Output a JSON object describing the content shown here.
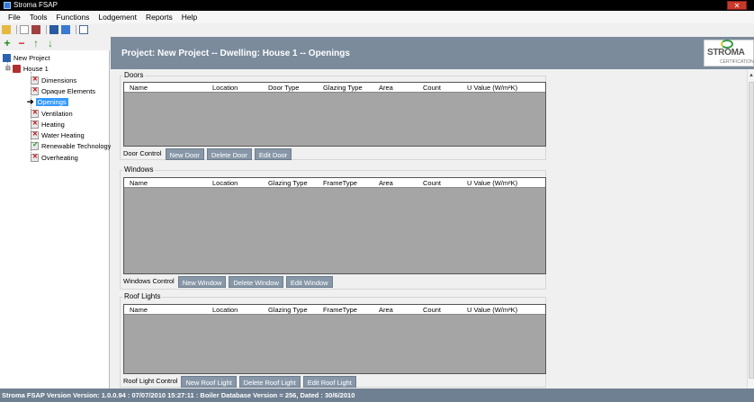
{
  "window": {
    "title": "Stroma FSAP",
    "close_label": "✕"
  },
  "menu": [
    "File",
    "Tools",
    "Functions",
    "Lodgement",
    "Reports",
    "Help"
  ],
  "toolbar2": {
    "add": "+",
    "remove": "−",
    "up": "↑",
    "down": "↓"
  },
  "tree": {
    "project": "New Project",
    "house": "House 1",
    "items": [
      {
        "label": "Dimensions",
        "status": "x"
      },
      {
        "label": "Opaque Elements",
        "status": "x"
      },
      {
        "label": "Openings",
        "status": "arrow"
      },
      {
        "label": "Ventilation",
        "status": "x"
      },
      {
        "label": "Heating",
        "status": "x"
      },
      {
        "label": "Water Heating",
        "status": "x"
      },
      {
        "label": "Renewable Technology",
        "status": "check"
      },
      {
        "label": "Overheating",
        "status": "x"
      }
    ]
  },
  "header": {
    "title": "Project: New Project -- Dwelling: House 1 -- Openings"
  },
  "logo": {
    "text": "STROMA",
    "subtitle": "CERTIFICATION"
  },
  "doors": {
    "label": "Doors",
    "columns": [
      "Name",
      "Location",
      "Door Type",
      "Glazing Type",
      "Area",
      "Count",
      "U Value (W/m²K)"
    ],
    "control_label": "Door Control",
    "buttons": [
      "New Door",
      "Delete Door",
      "Edit Door"
    ]
  },
  "windows": {
    "label": "Windows",
    "columns": [
      "Name",
      "Location",
      "Glazing Type",
      "FrameType",
      "Area",
      "Count",
      "U Value (W/m²K)"
    ],
    "control_label": "Windows Control",
    "buttons": [
      "New Window",
      "Delete Window",
      "Edit Window"
    ]
  },
  "rooflights": {
    "label": "Roof Lights",
    "columns": [
      "Name",
      "Location",
      "Glazing Type",
      "FrameType",
      "Area",
      "Count",
      "U Value (W/m²K)"
    ],
    "control_label": "Roof Light Control",
    "buttons": [
      "New Roof Light",
      "Delete Roof Light",
      "Edit Roof Light"
    ]
  },
  "status": {
    "text": "Stroma FSAP Version Version: 1.0.0.94  :  07/07/2010 15:27:11  :  Boiler Database Version = 256, Dated : 30/6/2010"
  }
}
